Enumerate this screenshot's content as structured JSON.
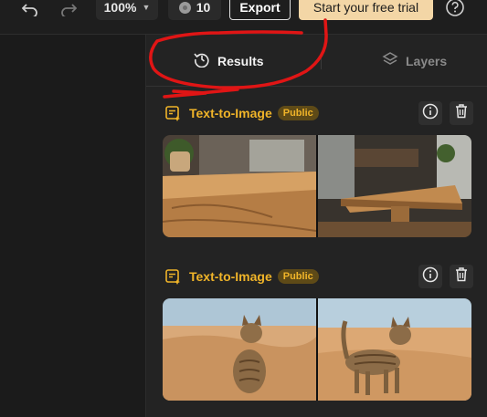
{
  "toolbar": {
    "zoom_value": "100%",
    "credits_count": "10",
    "export_label": "Export",
    "trial_label": "Start your free trial"
  },
  "panel": {
    "tabs": [
      {
        "label": "Results",
        "active": true,
        "icon": "history-icon"
      },
      {
        "label": "Layers",
        "active": false,
        "icon": "layers-icon"
      }
    ]
  },
  "results": [
    {
      "type_label": "Text-to-Image",
      "visibility": "Public",
      "images": [
        "wooden-table-closeup",
        "wooden-table-room"
      ]
    },
    {
      "type_label": "Text-to-Image",
      "visibility": "Public",
      "images": [
        "cat-desert-sitting",
        "cat-desert-standing"
      ]
    }
  ],
  "colors": {
    "accent": "#f0b429",
    "trial_button": "#f3d6a6",
    "annotation": "#e01515"
  }
}
